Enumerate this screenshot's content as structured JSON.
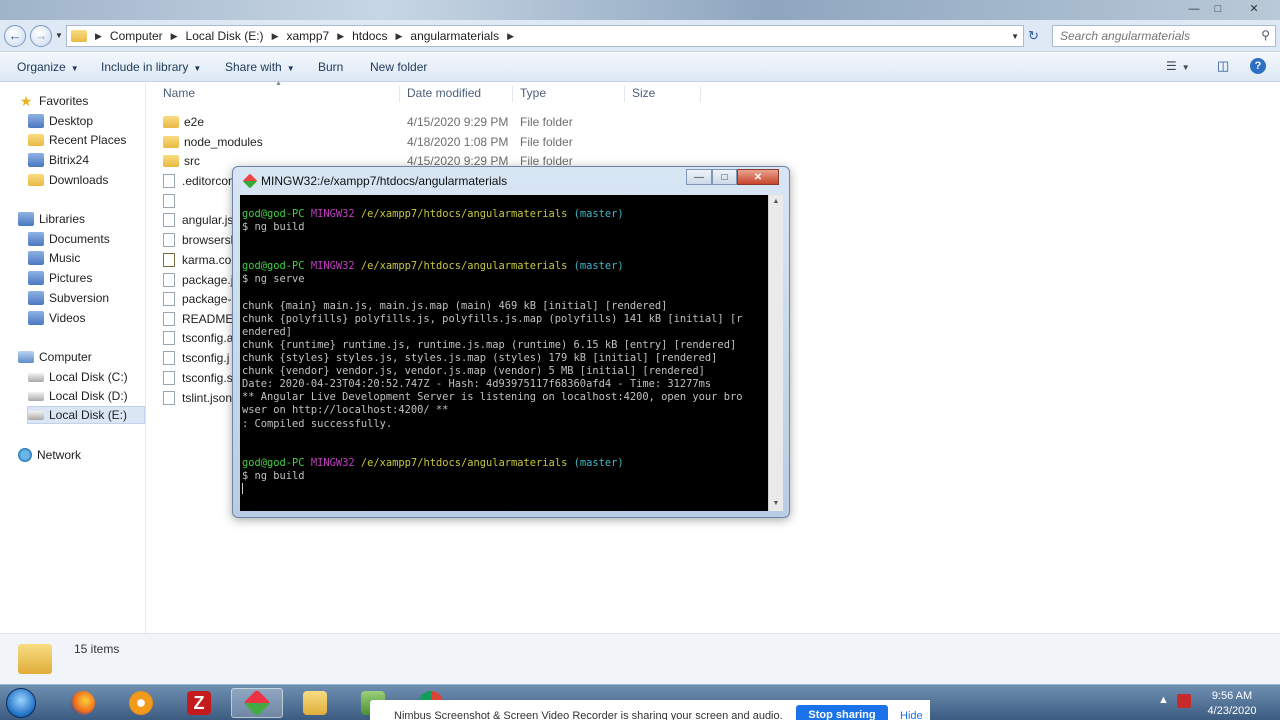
{
  "address": {
    "crumbs": [
      "Computer",
      "Local Disk (E:)",
      "xampp7",
      "htdocs",
      "angularmaterials"
    ],
    "search_placeholder": "Search angularmaterials"
  },
  "toolbar": {
    "organize": "Organize",
    "include": "Include in library",
    "share": "Share with",
    "burn": "Burn",
    "new_folder": "New folder"
  },
  "nav": {
    "favorites": "Favorites",
    "desktop": "Desktop",
    "recent": "Recent Places",
    "bitrix": "Bitrix24",
    "downloads": "Downloads",
    "libraries": "Libraries",
    "documents": "Documents",
    "music": "Music",
    "pictures": "Pictures",
    "subversion": "Subversion",
    "videos": "Videos",
    "computer": "Computer",
    "disk_c": "Local Disk (C:)",
    "disk_d": "Local Disk (D:)",
    "disk_e": "Local Disk (E:)",
    "network": "Network"
  },
  "columns": {
    "name": "Name",
    "date": "Date modified",
    "type": "Type",
    "size": "Size"
  },
  "files": [
    {
      "name": "e2e",
      "date": "4/15/2020 9:29 PM",
      "type": "File folder"
    },
    {
      "name": "node_modules",
      "date": "4/18/2020 1:08 PM",
      "type": "File folder"
    },
    {
      "name": "src",
      "date": "4/15/2020 9:29 PM",
      "type": "File folder"
    },
    {
      "name": ".editorcon"
    },
    {
      "name": ""
    },
    {
      "name": "angular.js"
    },
    {
      "name": "browserslis"
    },
    {
      "name": "karma.con"
    },
    {
      "name": "package.js"
    },
    {
      "name": "package-l"
    },
    {
      "name": "README.r"
    },
    {
      "name": "tsconfig.a"
    },
    {
      "name": "tsconfig.j"
    },
    {
      "name": "tsconfig.sp"
    },
    {
      "name": "tslint.json"
    }
  ],
  "status": {
    "items": "15 items"
  },
  "terminal": {
    "title": "MINGW32:/e/xampp7/htdocs/angularmaterials",
    "prompt": {
      "user": "god@god-PC",
      "env": "MINGW32",
      "path": "/e/xampp7/htdocs/angularmaterials",
      "branch": "(master)"
    },
    "cmd1": "$ ng build",
    "cmd2": "$ ng serve",
    "out": [
      "chunk {main} main.js, main.js.map (main) 469 kB [initial] [rendered]",
      "chunk {polyfills} polyfills.js, polyfills.js.map (polyfills) 141 kB [initial] [r",
      "endered]",
      "chunk {runtime} runtime.js, runtime.js.map (runtime) 6.15 kB [entry] [rendered]",
      "chunk {styles} styles.js, styles.js.map (styles) 179 kB [initial] [rendered]",
      "chunk {vendor} vendor.js, vendor.js.map (vendor) 5 MB [initial] [rendered]",
      "Date: 2020-04-23T04:20:52.747Z - Hash: 4d93975117f68360afd4 - Time: 31277ms",
      "** Angular Live Development Server is listening on localhost:4200, open your bro",
      "wser on http://localhost:4200/ **",
      ": Compiled successfully."
    ],
    "cmd3": "$ ng build"
  },
  "taskbar": {
    "share_text": "Nimbus Screenshot & Screen Video Recorder is sharing your screen and audio.",
    "stop": "Stop sharing",
    "hide": "Hide",
    "time": "9:56 AM",
    "date": "4/23/2020"
  }
}
